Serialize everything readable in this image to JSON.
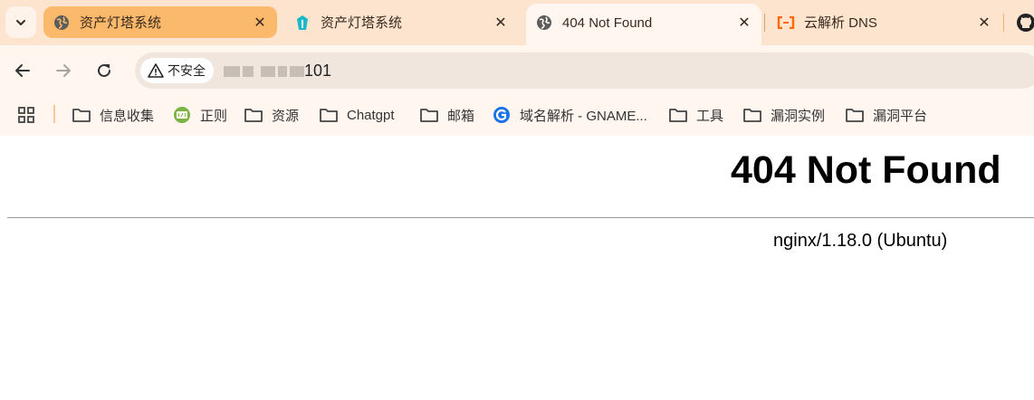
{
  "browser": {
    "tabs": [
      {
        "title": "资产灯塔系统",
        "favicon": "globe-icon",
        "state": "highlighted"
      },
      {
        "title": "资产灯塔系统",
        "favicon": "lighthouse-app-icon",
        "state": "normal"
      },
      {
        "title": "404 Not Found",
        "favicon": "globe-icon",
        "state": "active"
      },
      {
        "title": "云解析 DNS",
        "favicon": "aliyun-icon",
        "state": "normal"
      }
    ],
    "close_glyph": "✕"
  },
  "toolbar": {
    "security_label": "不安全",
    "url_visible_suffix": "101"
  },
  "bookmarks": [
    {
      "label": "信息收集",
      "icon": "folder-icon"
    },
    {
      "label": "正则",
      "icon": "regex-site-icon"
    },
    {
      "label": "资源",
      "icon": "folder-icon"
    },
    {
      "label": "Chatgpt",
      "icon": "folder-icon"
    },
    {
      "label": "邮箱",
      "icon": "folder-icon"
    },
    {
      "label": "域名解析 - GNAME...",
      "icon": "gname-site-icon"
    },
    {
      "label": "工具",
      "icon": "folder-icon"
    },
    {
      "label": "漏洞实例",
      "icon": "folder-icon"
    },
    {
      "label": "漏洞平台",
      "icon": "folder-icon"
    }
  ],
  "page": {
    "heading": "404 Not Found",
    "server_info": "nginx/1.18.0 (Ubuntu)"
  },
  "colors": {
    "tabstrip_bg": "#fde4cf",
    "highlight_tab_bg": "#fbb96b",
    "toolbar_bg": "#fff6f0",
    "accent_teal": "#1bb8c9",
    "aliyun_orange": "#ff6a00"
  }
}
